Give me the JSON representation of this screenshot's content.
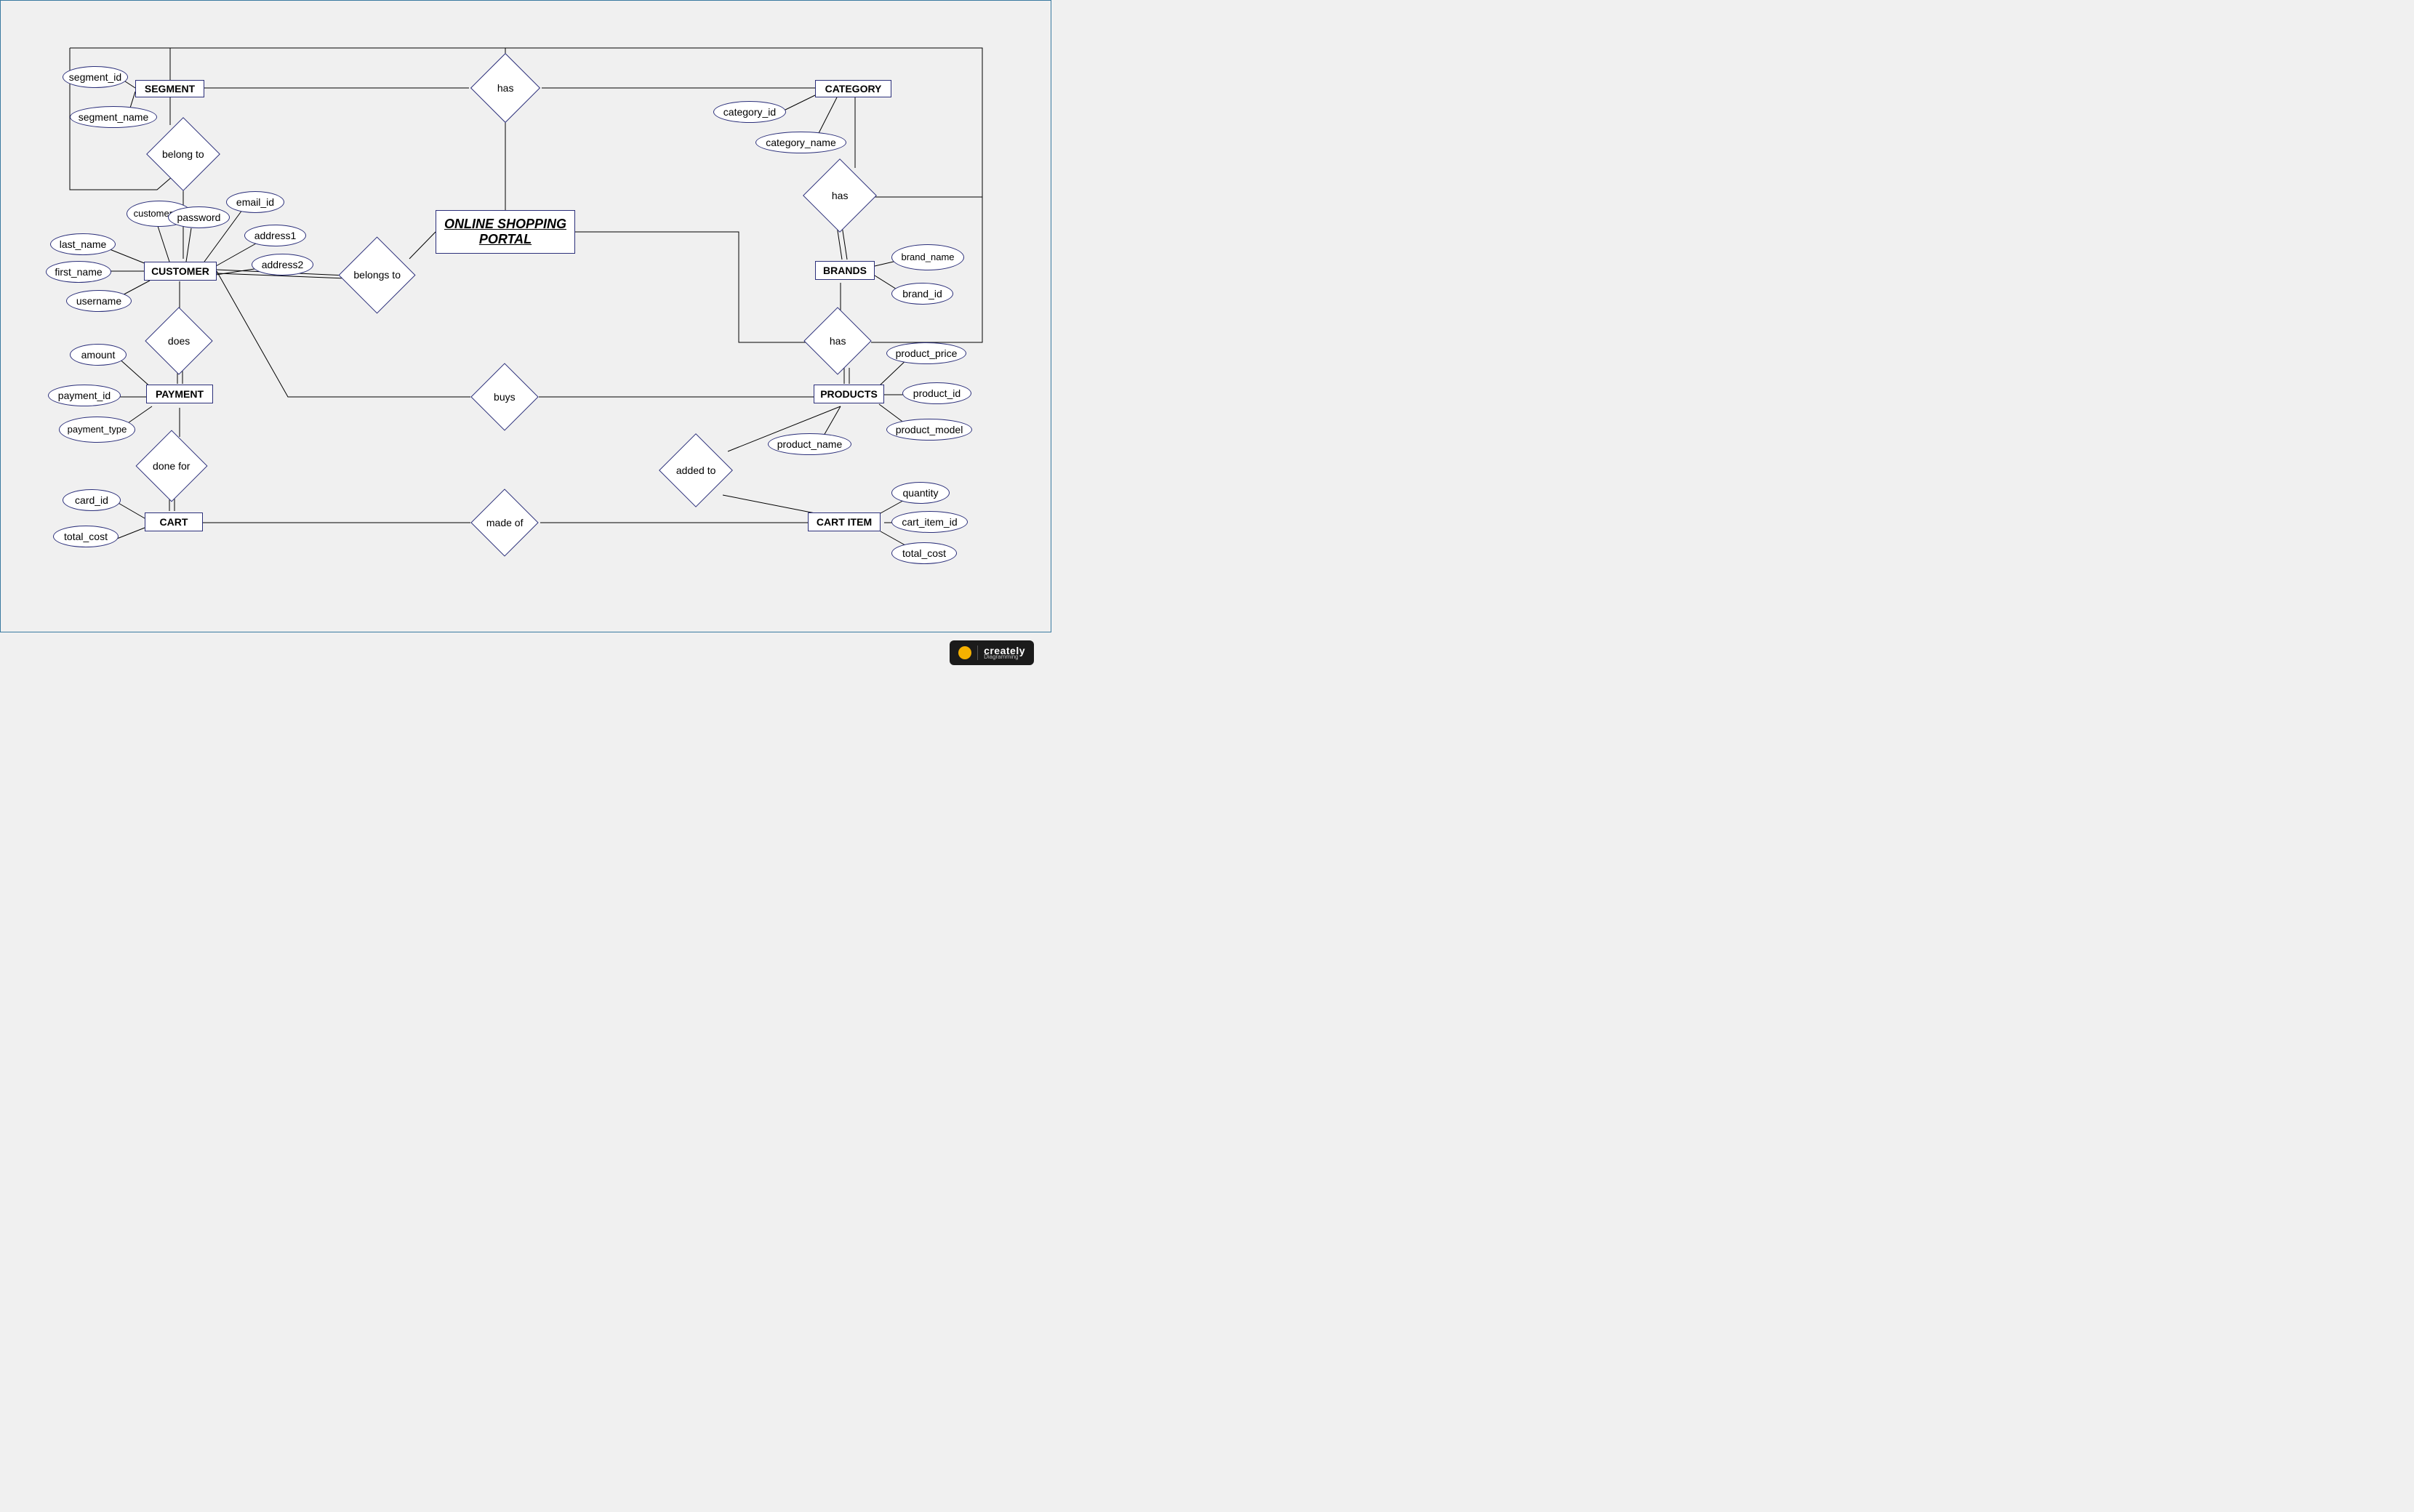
{
  "diagram": {
    "title": "ONLINE SHOPPING PORTAL",
    "entities": {
      "segment": {
        "label": "SEGMENT",
        "attrs": {
          "segment_id": "segment_id",
          "segment_name": "segment_name"
        }
      },
      "category": {
        "label": "CATEGORY",
        "attrs": {
          "category_id": "category_id",
          "category_name": "category_name"
        }
      },
      "customer": {
        "label": "CUSTOMER",
        "attrs": {
          "customer_id": "customer_id",
          "password": "password",
          "email_id": "email_id",
          "address1": "address1",
          "address2": "address2",
          "last_name": "last_name",
          "first_name": "first_name",
          "username": "username"
        }
      },
      "brands": {
        "label": "BRANDS",
        "attrs": {
          "brand_name": "brand_name",
          "brand_id": "brand_id"
        }
      },
      "payment": {
        "label": "PAYMENT",
        "attrs": {
          "amount": "amount",
          "payment_id": "payment_id",
          "payment_type": "payment_type"
        }
      },
      "products": {
        "label": "PRODUCTS",
        "attrs": {
          "product_price": "product_price",
          "product_id": "product_id",
          "product_model": "product_model",
          "product_name": "product_name"
        }
      },
      "cart": {
        "label": "CART",
        "attrs": {
          "card_id": "card_id",
          "total_cost": "total_cost"
        }
      },
      "cart_item": {
        "label": "CART ITEM",
        "attrs": {
          "quantity": "quantity",
          "cart_item_id": "cart_item_id",
          "total_cost": "total_cost"
        }
      }
    },
    "relationships": {
      "has_top": "has",
      "belong_to": "belong to",
      "has_cat_brand": "has",
      "belongs_to": "belongs to",
      "does": "does",
      "has_brand_prod": "has",
      "buys": "buys",
      "done_for": "done for",
      "added_to": "added to",
      "made_of": "made of"
    }
  },
  "footer": {
    "brand": "creately",
    "sub": "Diagramming"
  }
}
